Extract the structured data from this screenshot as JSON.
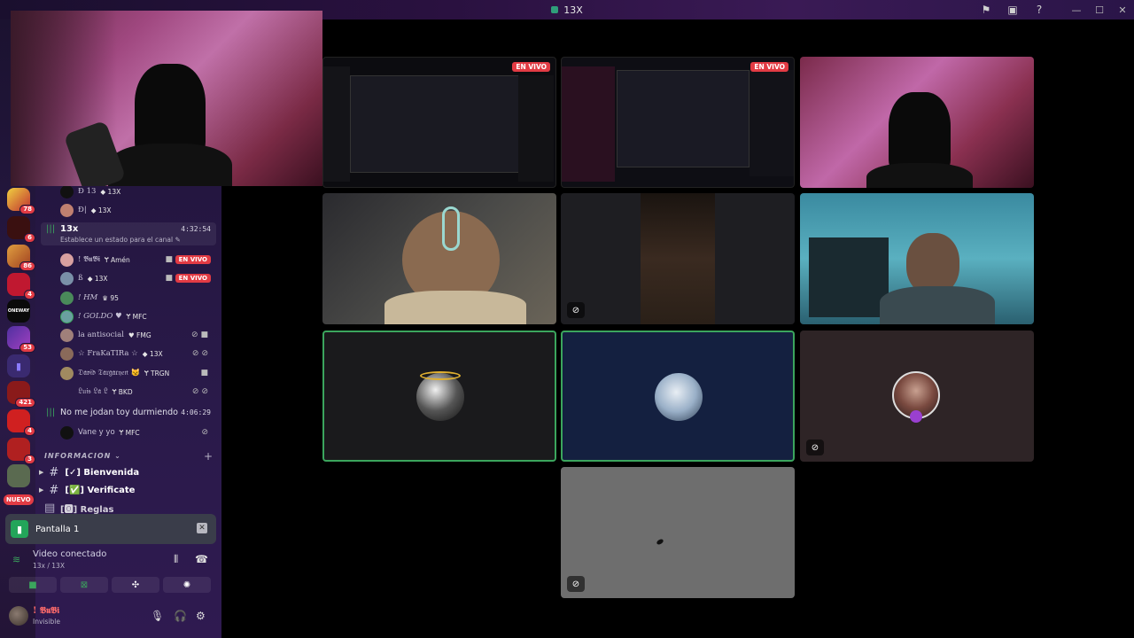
{
  "titlebar": {
    "title": "13X"
  },
  "rail": {
    "badges": [
      "78",
      "6",
      "86",
      "4",
      "53",
      "421",
      "4",
      "3"
    ],
    "nuevo": "NUEVO",
    "oneway": "ONEWAY"
  },
  "voice": {
    "pre_rows": [
      {
        "name": "Ð 13",
        "tag": "13X"
      },
      {
        "name": "Ð|",
        "tag": "13X"
      }
    ],
    "channel_13x": {
      "name": "13x",
      "status": "Establece un estado para el canal",
      "time": "4:32:54"
    },
    "members": [
      {
        "name": "! 𝕭𝖚𝕭𝖎",
        "tag": "Amén",
        "live": "EN VIVO",
        "color": "#d8a0a0"
      },
      {
        "name": "ß",
        "tag": "13X",
        "live": "EN VIVO",
        "color": "#7a90a8"
      },
      {
        "name": "! HM",
        "tag": "♛ 95",
        "color": "#4a8a5a"
      },
      {
        "name": "! GOLDO ♥",
        "tag": "MFC",
        "color": "#6aa0a0"
      },
      {
        "name": "la antisocial",
        "tag": "FMG",
        "color": "#a0807a"
      },
      {
        "name": "☆ FraKaTIRa ☆",
        "tag": "13X",
        "color": "#8a6a5a"
      },
      {
        "name": "𝔇𝔞𝔳𝔦𝔡 𝔗𝔞𝔯𝔤𝔞𝔯𝔶𝔢𝔫 😼",
        "tag": "TRGN",
        "color": "#a08a60"
      },
      {
        "name": "𝔏𝔲𝔦𝔰 𝔏𝔞 𝔏",
        "tag": "BKD"
      }
    ],
    "channel_2": {
      "name": "No me jodan toy durmiendo",
      "time": "4:06:29"
    },
    "members2": [
      {
        "name": "Vane y yo",
        "tag": "MFC"
      }
    ]
  },
  "category": {
    "name": "INFORMACION",
    "add": "+"
  },
  "text_channels": [
    {
      "name": "[✓] Bienvenida"
    },
    {
      "name": "[✅] Verificate"
    },
    {
      "name": "[🅾] Reglas"
    }
  ],
  "screen_share": {
    "label": "Pantalla 1"
  },
  "connection": {
    "status": "Video conectado",
    "location": "13x / 13X"
  },
  "user": {
    "name": "! 𝕭𝖚𝕭𝖎",
    "status": "Invisible"
  },
  "grid": {
    "live_label": "EN VIVO"
  },
  "colors": {
    "accent_green": "#23a55a",
    "live_red": "#e23b44",
    "speaking_border": "#3ba55d"
  }
}
